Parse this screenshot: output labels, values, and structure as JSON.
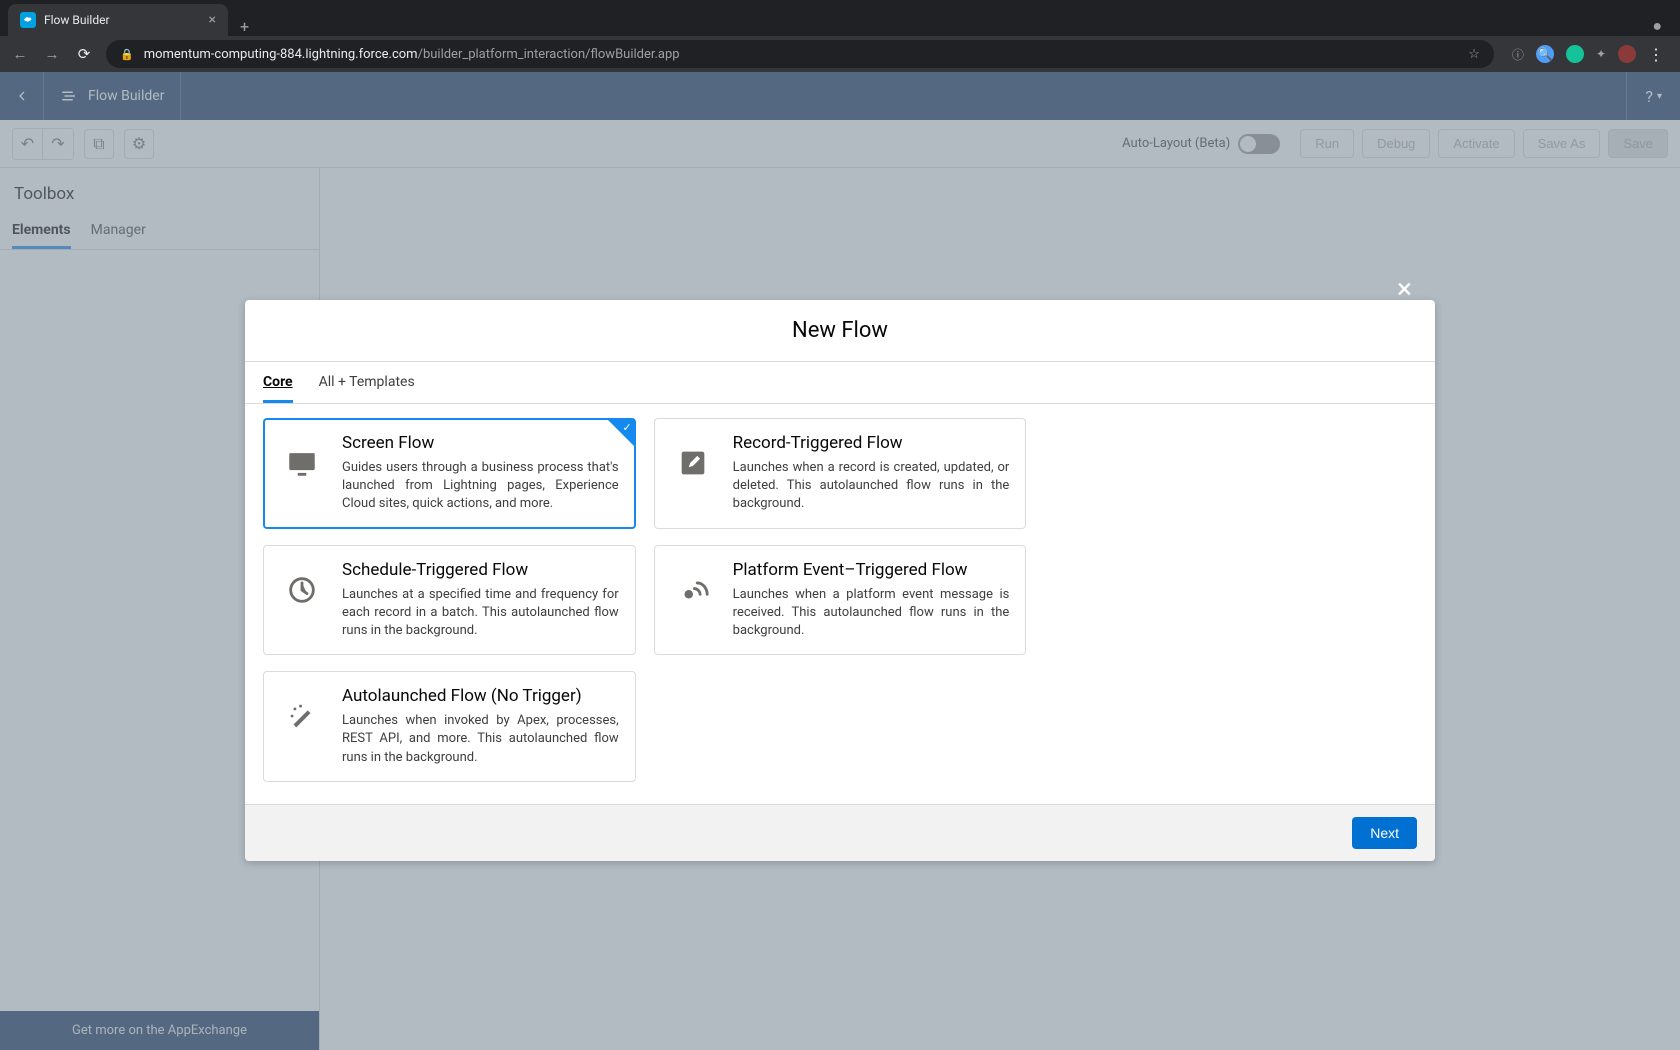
{
  "browser": {
    "tab_title": "Flow Builder",
    "url_host": "momentum-computing-884.lightning.force.com",
    "url_path": "/builder_platform_interaction/flowBuilder.app"
  },
  "app_header": {
    "title": "Flow Builder"
  },
  "toolbar": {
    "autolayout_label": "Auto-Layout (Beta)",
    "run": "Run",
    "debug": "Debug",
    "activate": "Activate",
    "save_as": "Save As",
    "save": "Save"
  },
  "sidebar": {
    "title": "Toolbox",
    "tabs": {
      "elements": "Elements",
      "manager": "Manager"
    },
    "footer": "Get more on the AppExchange"
  },
  "modal": {
    "title": "New Flow",
    "tabs": {
      "core": "Core",
      "all": "All + Templates"
    },
    "next": "Next",
    "cards": [
      {
        "title": "Screen Flow",
        "desc": "Guides users through a business process that's launched from Lightning pages, Experience Cloud sites, quick actions, and more."
      },
      {
        "title": "Record-Triggered Flow",
        "desc": "Launches when a record is created, updated, or deleted. This autolaunched flow runs in the background."
      },
      {
        "title": "Schedule-Triggered Flow",
        "desc": "Launches at a specified time and frequency for each record in a batch. This autolaunched flow runs in the background."
      },
      {
        "title": "Platform Event–Triggered Flow",
        "desc": "Launches when a platform event message is received. This autolaunched flow runs in the background."
      },
      {
        "title": "Autolaunched Flow (No Trigger)",
        "desc": "Launches when invoked by Apex, processes, REST API, and more. This autolaunched flow runs in the background."
      }
    ]
  }
}
